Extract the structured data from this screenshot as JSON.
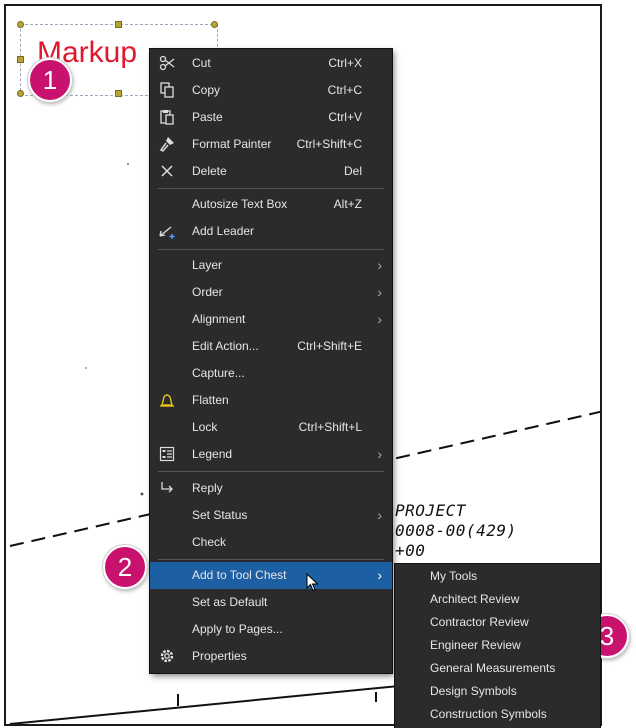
{
  "canvas": {
    "markup_text": "Markup",
    "project_lines": [
      "PROJECT",
      "0008-00(429)",
      "+00"
    ]
  },
  "badges": [
    "1",
    "2",
    "3"
  ],
  "colors": {
    "menu_bg": "#2b2b2b",
    "highlight": "#1d5fa3",
    "badge": "#c8126d",
    "markup_text": "#e0182d"
  },
  "context_menu": {
    "items": [
      {
        "label": "Cut",
        "shortcut": "Ctrl+X",
        "icon": "scissors-icon"
      },
      {
        "label": "Copy",
        "shortcut": "Ctrl+C",
        "icon": "copy-icon"
      },
      {
        "label": "Paste",
        "shortcut": "Ctrl+V",
        "icon": "paste-icon"
      },
      {
        "label": "Format Painter",
        "shortcut": "Ctrl+Shift+C",
        "icon": "format-painter-icon"
      },
      {
        "label": "Delete",
        "shortcut": "Del",
        "icon": "close-icon"
      },
      {
        "label": "Autosize Text Box",
        "shortcut": "Alt+Z"
      },
      {
        "label": "Add Leader",
        "icon": "add-leader-icon"
      },
      {
        "label": "Layer",
        "submenu": true
      },
      {
        "label": "Order",
        "submenu": true
      },
      {
        "label": "Alignment",
        "submenu": true
      },
      {
        "label": "Edit Action...",
        "shortcut": "Ctrl+Shift+E"
      },
      {
        "label": "Capture..."
      },
      {
        "label": "Flatten",
        "icon": "bell-icon"
      },
      {
        "label": "Lock",
        "shortcut": "Ctrl+Shift+L"
      },
      {
        "label": "Legend",
        "submenu": true,
        "icon": "legend-icon"
      },
      {
        "label": "Reply",
        "icon": "reply-icon"
      },
      {
        "label": "Set Status",
        "submenu": true
      },
      {
        "label": "Check"
      },
      {
        "label": "Add to Tool Chest",
        "submenu": true,
        "highlighted": true
      },
      {
        "label": "Set as Default"
      },
      {
        "label": "Apply to Pages..."
      },
      {
        "label": "Properties",
        "icon": "gear-icon"
      }
    ]
  },
  "submenu": {
    "items": [
      "My Tools",
      "Architect Review",
      "Contractor Review",
      "Engineer Review",
      "General Measurements",
      "Design Symbols",
      "Construction Symbols"
    ]
  }
}
